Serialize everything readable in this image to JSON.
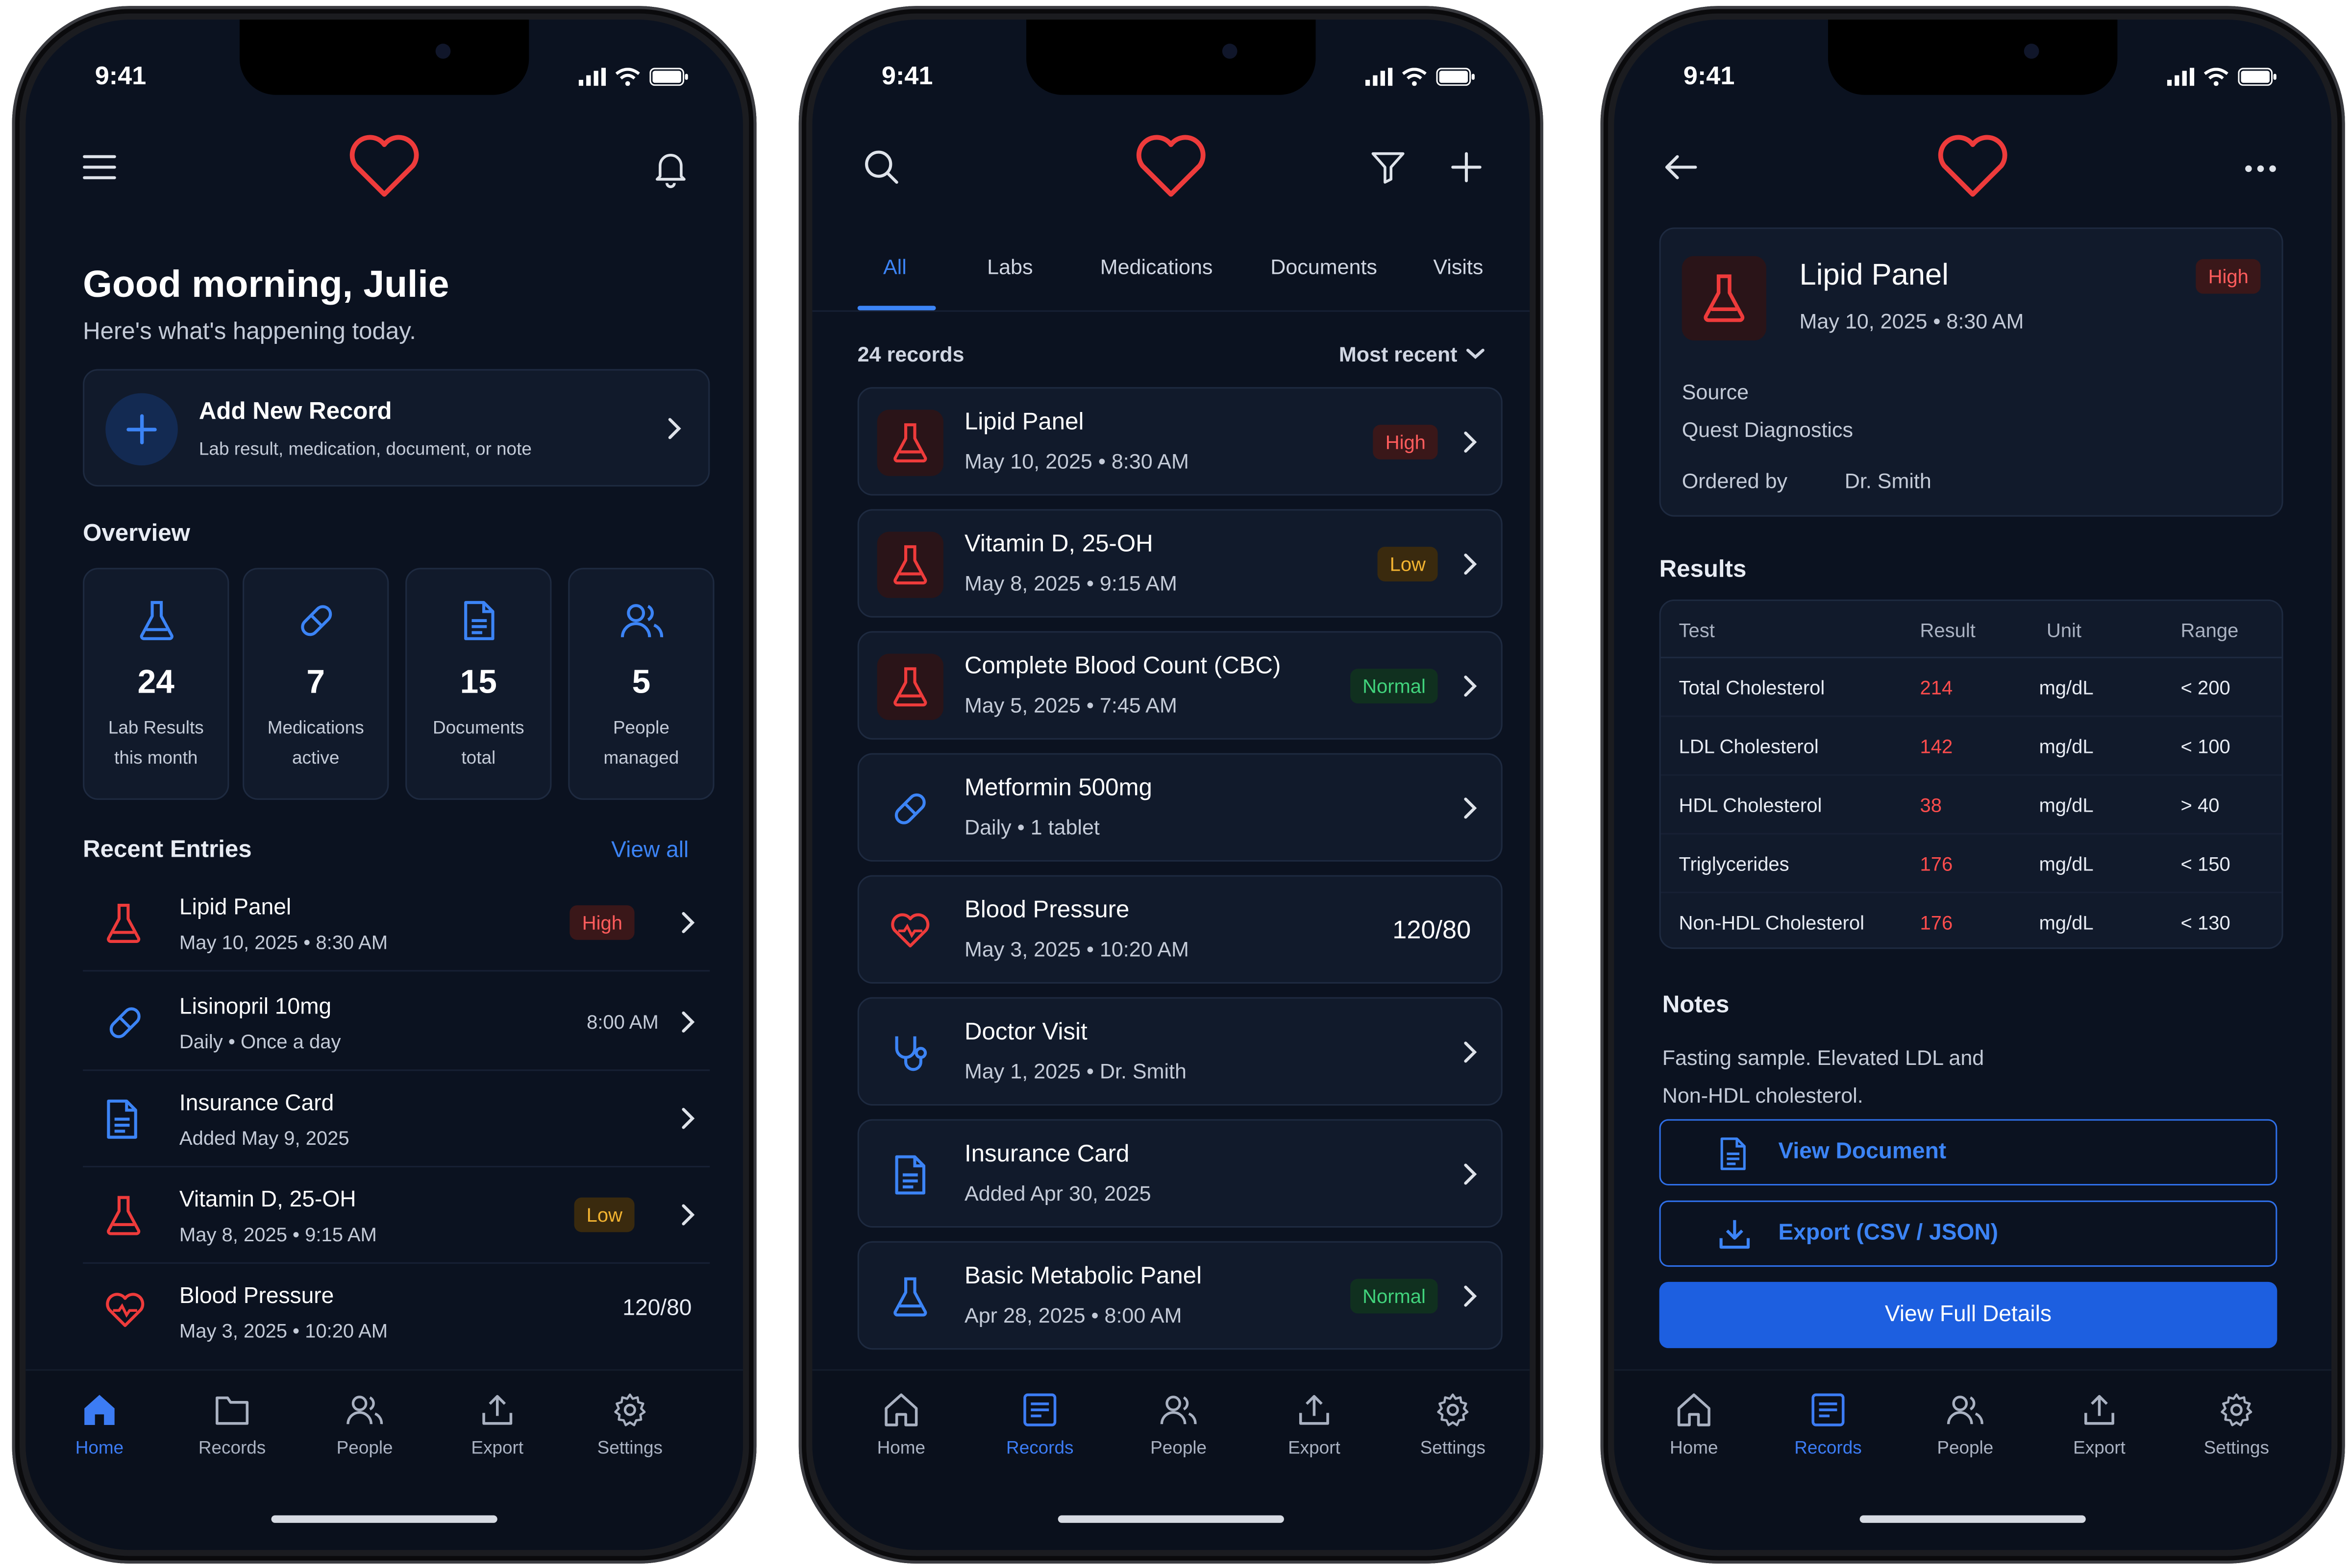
{
  "status": {
    "time": "9:41"
  },
  "colors": {
    "accent": "#3c84f6",
    "brand_heart": "#ee3b3b",
    "background": "#0b1220",
    "high": "#ff5c5c",
    "low": "#f3b431",
    "normal": "#41d37c"
  },
  "home": {
    "greeting": "Good morning, Julie",
    "greeting_sub": "Here's what's happening today.",
    "add_record": {
      "title": "Add New Record",
      "subtitle": "Lab result, medication, document, or note"
    },
    "overview_title": "Overview",
    "overview": [
      {
        "icon": "flask-icon",
        "value": "24",
        "label1": "Lab Results",
        "label2": "this month"
      },
      {
        "icon": "pill-icon",
        "value": "7",
        "label1": "Medications",
        "label2": "active"
      },
      {
        "icon": "document-icon",
        "value": "15",
        "label1": "Documents",
        "label2": "total"
      },
      {
        "icon": "people-icon",
        "value": "5",
        "label1": "People",
        "label2": "managed"
      }
    ],
    "recent_title": "Recent Entries",
    "view_all": "View all",
    "entries": [
      {
        "icon": "flask-icon",
        "title": "Lipid Panel",
        "subtitle": "May 10, 2025  •  8:30 AM",
        "badge": "High",
        "badge_type": "high"
      },
      {
        "icon": "pill-icon",
        "title": "Lisinopril 10mg",
        "subtitle": "Daily  •  Once a day",
        "right_text": "8:00 AM"
      },
      {
        "icon": "document-icon",
        "title": "Insurance Card",
        "subtitle": "Added May 9, 2025"
      },
      {
        "icon": "flask-icon",
        "title": "Vitamin D, 25-OH",
        "subtitle": "May 8, 2025  •  9:15 AM",
        "badge": "Low",
        "badge_type": "low"
      },
      {
        "icon": "heart-pulse-icon",
        "title": "Blood Pressure",
        "subtitle": "May 3, 2025  •  10:20 AM",
        "value": "120/80"
      }
    ]
  },
  "records": {
    "tabs": [
      "All",
      "Labs",
      "Medications",
      "Documents",
      "Visits"
    ],
    "active_tab": "All",
    "count": "24 records",
    "sort": "Most recent",
    "items": [
      {
        "icon": "flask-icon",
        "title": "Lipid Panel",
        "subtitle": "May 10, 2025  •  8:30 AM",
        "badge": "High",
        "badge_type": "high"
      },
      {
        "icon": "flask-icon",
        "title": "Vitamin D, 25-OH",
        "subtitle": "May 8, 2025  •  9:15 AM",
        "badge": "Low",
        "badge_type": "low"
      },
      {
        "icon": "flask-icon",
        "title": "Complete Blood Count (CBC)",
        "subtitle": "May 5, 2025  •  7:45 AM",
        "badge": "Normal",
        "badge_type": "normal"
      },
      {
        "icon": "pill-icon",
        "title": "Metformin 500mg",
        "subtitle": "Daily  •  1 tablet"
      },
      {
        "icon": "heart-pulse-icon",
        "title": "Blood Pressure",
        "subtitle": "May 3, 2025  •  10:20 AM",
        "value": "120/80"
      },
      {
        "icon": "stethoscope-icon",
        "title": "Doctor Visit",
        "subtitle": "May 1, 2025  •  Dr. Smith"
      },
      {
        "icon": "document-icon",
        "title": "Insurance Card",
        "subtitle": "Added Apr 30, 2025"
      },
      {
        "icon": "flask-icon",
        "title": "Basic Metabolic Panel",
        "subtitle": "Apr 28, 2025  •  8:00 AM",
        "badge": "Normal",
        "badge_type": "normal"
      }
    ]
  },
  "detail": {
    "title": "Lipid Panel",
    "subtitle": "May 10, 2025  •  8:30 AM",
    "badge": "High",
    "source_label": "Source",
    "source_value": "Quest Diagnostics",
    "ordered_label": "Ordered by",
    "ordered_value": "Dr. Smith",
    "results_title": "Results",
    "columns": [
      "Test",
      "Result",
      "Unit",
      "Range"
    ],
    "rows": [
      {
        "test": "Total Cholesterol",
        "result": "214",
        "unit": "mg/dL",
        "range": "< 200"
      },
      {
        "test": "LDL Cholesterol",
        "result": "142",
        "unit": "mg/dL",
        "range": "< 100"
      },
      {
        "test": "HDL Cholesterol",
        "result": "38",
        "unit": "mg/dL",
        "range": "> 40"
      },
      {
        "test": "Triglycerides",
        "result": "176",
        "unit": "mg/dL",
        "range": "< 150"
      },
      {
        "test": "Non-HDL Cholesterol",
        "result": "176",
        "unit": "mg/dL",
        "range": "< 130"
      }
    ],
    "notes_title": "Notes",
    "notes_line1": "Fasting sample. Elevated LDL and",
    "notes_line2": "Non-HDL cholesterol.",
    "view_document": "View Document",
    "export": "Export (CSV / JSON)",
    "view_full": "View Full Details"
  },
  "tabbar": [
    "Home",
    "Records",
    "People",
    "Export",
    "Settings"
  ]
}
